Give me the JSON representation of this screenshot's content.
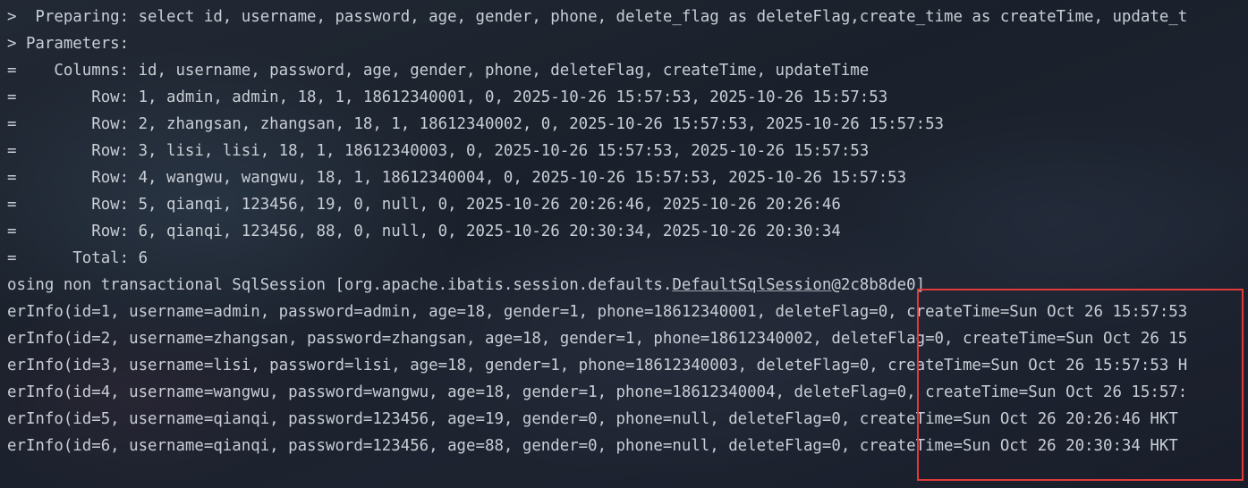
{
  "console": {
    "lines": [
      ">  Preparing: select id, username, password, age, gender, phone, delete_flag as deleteFlag,create_time as createTime, update_t",
      "> Parameters: ",
      "=    Columns: id, username, password, age, gender, phone, deleteFlag, createTime, updateTime",
      "=        Row: 1, admin, admin, 18, 1, 18612340001, 0, 2025-10-26 15:57:53, 2025-10-26 15:57:53",
      "=        Row: 2, zhangsan, zhangsan, 18, 1, 18612340002, 0, 2025-10-26 15:57:53, 2025-10-26 15:57:53",
      "=        Row: 3, lisi, lisi, 18, 1, 18612340003, 0, 2025-10-26 15:57:53, 2025-10-26 15:57:53",
      "=        Row: 4, wangwu, wangwu, 18, 1, 18612340004, 0, 2025-10-26 15:57:53, 2025-10-26 15:57:53",
      "=        Row: 5, qianqi, 123456, 19, 0, null, 0, 2025-10-26 20:26:46, 2025-10-26 20:26:46",
      "=        Row: 6, qianqi, 123456, 88, 0, null, 0, 2025-10-26 20:30:34, 2025-10-26 20:30:34",
      "=      Total: 6"
    ],
    "closing_line": {
      "prefix": "osing non transactional SqlSession [org.apache.ibatis.session.defaults.",
      "link": "DefaultSqlSession",
      "suffix": "@2c8b8de0]"
    },
    "result_lines": [
      "erInfo(id=1, username=admin, password=admin, age=18, gender=1, phone=18612340001, deleteFlag=0, createTime=Sun Oct 26 15:57:53",
      "erInfo(id=2, username=zhangsan, password=zhangsan, age=18, gender=1, phone=18612340002, deleteFlag=0, createTime=Sun Oct 26 15",
      "erInfo(id=3, username=lisi, password=lisi, age=18, gender=1, phone=18612340003, deleteFlag=0, createTime=Sun Oct 26 15:57:53 H",
      "erInfo(id=4, username=wangwu, password=wangwu, age=18, gender=1, phone=18612340004, deleteFlag=0, createTime=Sun Oct 26 15:57:",
      "erInfo(id=5, username=qianqi, password=123456, age=19, gender=0, phone=null, deleteFlag=0, createTime=Sun Oct 26 20:26:46 HKT",
      "erInfo(id=6, username=qianqi, password=123456, age=88, gender=0, phone=null, deleteFlag=0, createTime=Sun Oct 26 20:30:34 HKT"
    ]
  },
  "colors": {
    "text": "#c9ced6",
    "highlight_border": "#e03a3a"
  }
}
